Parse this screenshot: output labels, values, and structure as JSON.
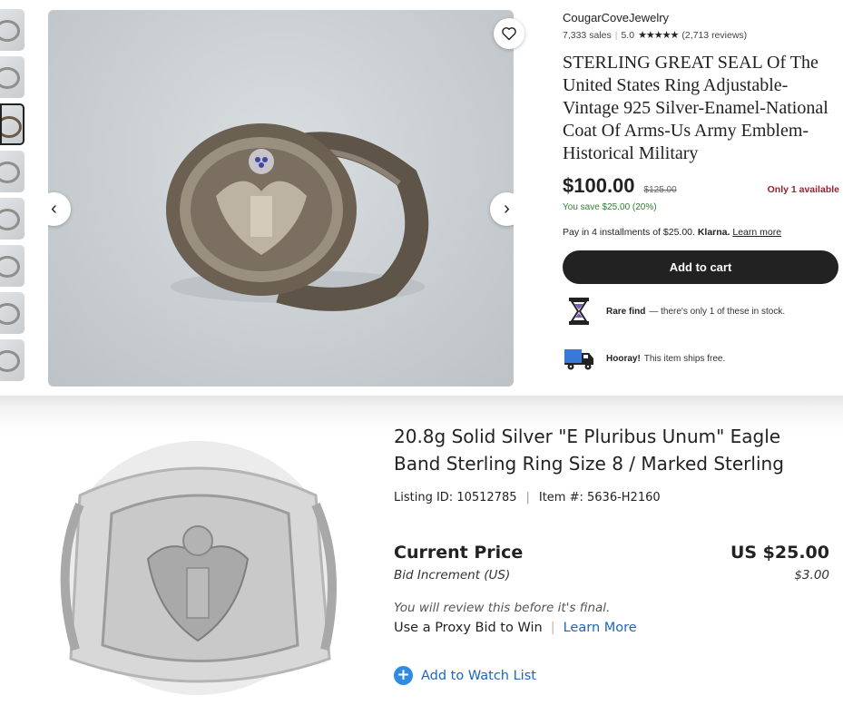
{
  "listing_top": {
    "shop_name": "CougarCoveJewelry",
    "sales": "7,333 sales",
    "rating": "5.0",
    "stars": "★★★★★",
    "reviews": "(2,713 reviews)",
    "title": "STERLING GREAT SEAL Of The United States Ring Adjustable-Vintage 925 Silver-Enamel-National Coat Of Arms-Us Army Emblem-Historical Military",
    "price": "$100.00",
    "original_price": "$125.00",
    "availability": "Only 1 available",
    "savings": "You save $25.00 (20%)",
    "installments_text": "Pay in 4 installments of $25.00.",
    "klarna_brand": "Klarna.",
    "learn_more": "Learn more",
    "add_to_cart": "Add to cart",
    "perk_rare_title": "Rare find",
    "perk_rare_text": "— there's only 1 of these in stock.",
    "perk_ship_title": "Hooray!",
    "perk_ship_text": "This item ships free.",
    "prev_arrow": "‹",
    "next_arrow": "›",
    "icons": [
      "heart-icon",
      "chevron-left-icon",
      "chevron-right-icon",
      "hourglass-icon",
      "truck-icon"
    ],
    "accent_colors": {
      "availability": "#a61a2e",
      "savings": "#2f7d32",
      "cart_button": "#222222"
    }
  },
  "listing_bottom": {
    "title": "20.8g Solid Silver \"E Pluribus Unum\" Eagle Band Sterling Ring Size 8 / Marked Sterling",
    "listing_id": "Listing ID: 10512785",
    "item_number": "Item #: 5636-H2160",
    "current_price_label": "Current Price",
    "current_price": "US $25.00",
    "bid_increment_label": "Bid Increment (US)",
    "bid_increment": "$3.00",
    "review_note": "You will review this before it's final.",
    "proxy_text": "Use a Proxy Bid to Win",
    "learn_more": "Learn More",
    "watch_list": "Add to Watch List",
    "watch_icon": "+",
    "accent_colors": {
      "link": "#1a66c2",
      "watch_icon": "#2f8ae0"
    }
  }
}
